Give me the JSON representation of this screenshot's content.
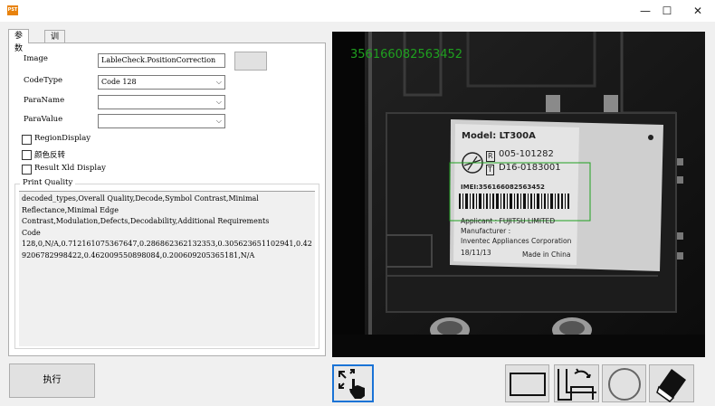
{
  "window": {
    "app_icon_text": "PST",
    "minimize_glyph": "—",
    "maximize_glyph": "☐",
    "close_glyph": "✕"
  },
  "tabs": [
    {
      "label": "参数",
      "active": true
    },
    {
      "label": "训练",
      "active": false
    }
  ],
  "params": {
    "image_label": "Image",
    "image_value": "LableCheck.PositionCorrection",
    "codetype_label": "CodeType",
    "codetype_value": "Code 128",
    "paraname_label": "ParaName",
    "paraname_value": "",
    "paravalue_label": "ParaValue",
    "paravalue_value": ""
  },
  "checkboxes": [
    {
      "label": "RegionDisplay",
      "checked": false
    },
    {
      "label": "颜色反转",
      "checked": false
    },
    {
      "label": "Result Xld Display",
      "checked": false
    }
  ],
  "print_quality": {
    "title": "Print Quality",
    "lines": [
      "decoded_types,Overall Quality,Decode,Symbol Contrast,Minimal",
      "Reflectance,Minimal Edge",
      "Contrast,Modulation,Defects,Decodability,Additional Requirements",
      "Code",
      "128,0,N/A,0.712161075367647,0.286862362132353,0.305623651102941,0.42",
      "9206782998422,0.462009550898084,0.200609205365181,N/A"
    ]
  },
  "run_button": "执行",
  "viewer": {
    "overlay_code": "356166082563452",
    "overlay_color": "#1fa01f",
    "label": {
      "model": "Model: LT300A",
      "r_mark": "R",
      "r_number": "005-101282",
      "t_mark": "T",
      "t_number": "D16-0183001",
      "imei": "IMEI:356166082563452",
      "applicant": "Applicant : FUJITSU LIMITED",
      "manufacturer": "Manufacturer :",
      "manufacturer_name": "Inventec Appliances Corporation",
      "date": "18/11/13",
      "origin": "Made in China"
    }
  },
  "tools": [
    {
      "name": "zoom-pan",
      "icon": "hand-pointer-icon",
      "selected": true
    },
    {
      "name": "rectangle",
      "icon": "rectangle-icon"
    },
    {
      "name": "rotated-rectangle",
      "icon": "rotated-rectangle-icon"
    },
    {
      "name": "circle",
      "icon": "circle-icon"
    },
    {
      "name": "eraser",
      "icon": "eraser-icon"
    }
  ],
  "colors": {
    "accent": "#1a73d6",
    "overlay": "#1fa01f",
    "background": "#f0f0f0"
  }
}
